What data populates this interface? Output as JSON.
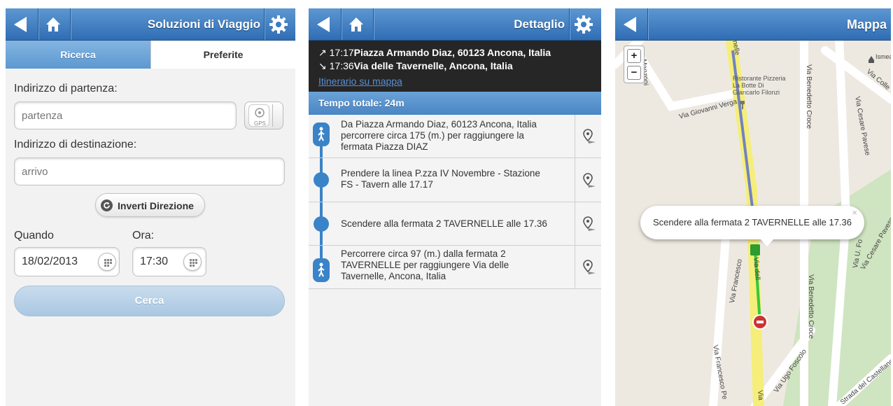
{
  "screen1": {
    "title": "Soluzioni di Viaggio",
    "tabs": [
      "Ricerca",
      "Preferite"
    ],
    "departure_label": "Indirizzo di partenza:",
    "departure_placeholder": "partenza",
    "gps_label": "GPS",
    "destination_label": "Indirizzo di destinazione:",
    "destination_placeholder": "arrivo",
    "invert_label": "Inverti Direzione",
    "when_label": "Quando",
    "time_label": "Ora:",
    "date_value": "18/02/2013",
    "time_value": "17:30",
    "search_label": "Cerca"
  },
  "screen2": {
    "title": "Dettaglio",
    "depart_time": "17:17",
    "depart_place": "Piazza Armando Diaz, 60123 Ancona, Italia",
    "arrive_time": "17:36",
    "arrive_place": "Via delle Tavernelle, Ancona, Italia",
    "map_link": "Itinerario su mappa",
    "total_time": "Tempo totale: 24m",
    "steps": [
      {
        "type": "walk",
        "text": "Da Piazza Armando Diaz, 60123 Ancona, Italia percorrere circa 175 (m.) per raggiungere la fermata Piazza DIAZ"
      },
      {
        "type": "bus",
        "text": "Prendere la linea P.zza IV Novembre - Stazione FS - Tavern alle 17.17"
      },
      {
        "type": "bus",
        "text": "Scendere alla fermata 2 TAVERNELLE alle 17.36"
      },
      {
        "type": "walk",
        "text": "Percorrere circa 97 (m.) dalla fermata 2 TAVERNELLE per raggiungere Via delle Tavernelle, Ancona, Italia"
      }
    ]
  },
  "screen3": {
    "title": "Mappa",
    "zoom_in": "+",
    "zoom_out": "−",
    "popup_text": "Scendere alla fermata 2 TAVERNELLE alle 17.36",
    "popup_close": "×",
    "poi_restaurant": [
      "Ristorante Pizzeria",
      "La Botte Di",
      "Giancarlo Filonzi"
    ],
    "poi_ismea": "Ismea",
    "roads": {
      "giovanni_verga": "Via Giovanni Verga",
      "benedetto_croce_1": "Via Benedetto Croce",
      "benedetto_croce_2": "Via Benedetto Croce",
      "cesare_pavese_1": "Via Cesare Pavese",
      "cesare_pavese_2": "Via Cesare Pavese",
      "colle": "Via Colle",
      "francesco_1": "Via Francesco",
      "francesco_2": "Via Francesco Pe",
      "ugo_foscolo_1": "Via U. Fo",
      "ugo_foscolo_2": "Via Ugo Foscolo",
      "castellano": "Strada del Castellano",
      "delle_tav_1": "Via dell",
      "delle_tav_2": "Via",
      "manzoni": "Manzoni",
      "nelle": "nelle"
    }
  },
  "colors": {
    "header": "#3a7cc0",
    "accent": "#3a83c8",
    "route_bus": "#5a6fd0",
    "route_walk": "#36c83a",
    "route_road": "#f5ee7a"
  }
}
